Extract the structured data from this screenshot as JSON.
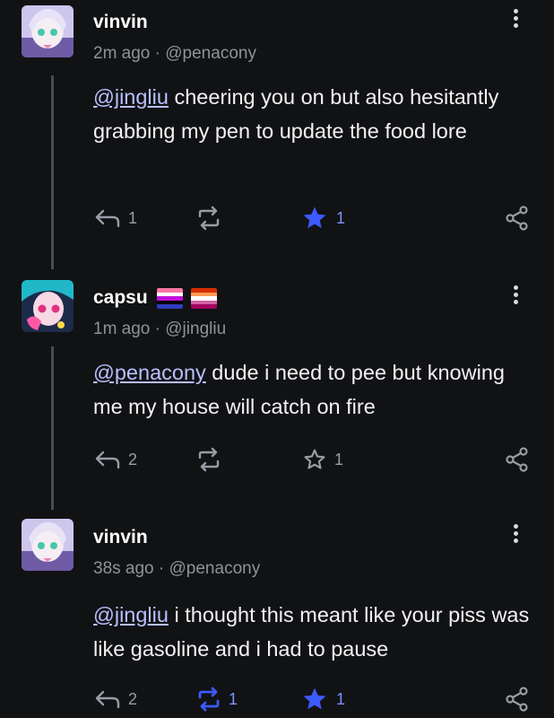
{
  "posts": [
    {
      "author": "vinvin",
      "time": "2m ago",
      "handle": "@penacony",
      "mention": "@jingliu",
      "text": " cheering you on but also hesitantly grabbing my pen to update the food lore",
      "reply_count": "1",
      "repost_count": "",
      "star_count": "1",
      "starred": true,
      "reposted": false
    },
    {
      "author": "capsu",
      "time": "1m ago",
      "handle": "@jingliu",
      "mention": "@penacony",
      "text": " dude i need to pee but knowing me my house will catch on fire",
      "reply_count": "2",
      "repost_count": "",
      "star_count": "1",
      "starred": false,
      "reposted": false
    },
    {
      "author": "vinvin",
      "time": "38s ago",
      "handle": "@penacony",
      "mention": "@jingliu",
      "text": " i thought this meant like your piss was like gasoline and i had to pause",
      "reply_count": "2",
      "repost_count": "1",
      "star_count": "1",
      "starred": true,
      "reposted": true
    }
  ],
  "meta_separator": "·",
  "colors": {
    "background": "#111214",
    "accent": "#3d5afe",
    "muted": "#8f929b",
    "mention": "#b6c0ff"
  },
  "icons": {
    "reply": "reply-icon",
    "repost": "repost-icon",
    "star": "star-icon",
    "share": "share-icon",
    "more": "more-vertical-icon"
  }
}
